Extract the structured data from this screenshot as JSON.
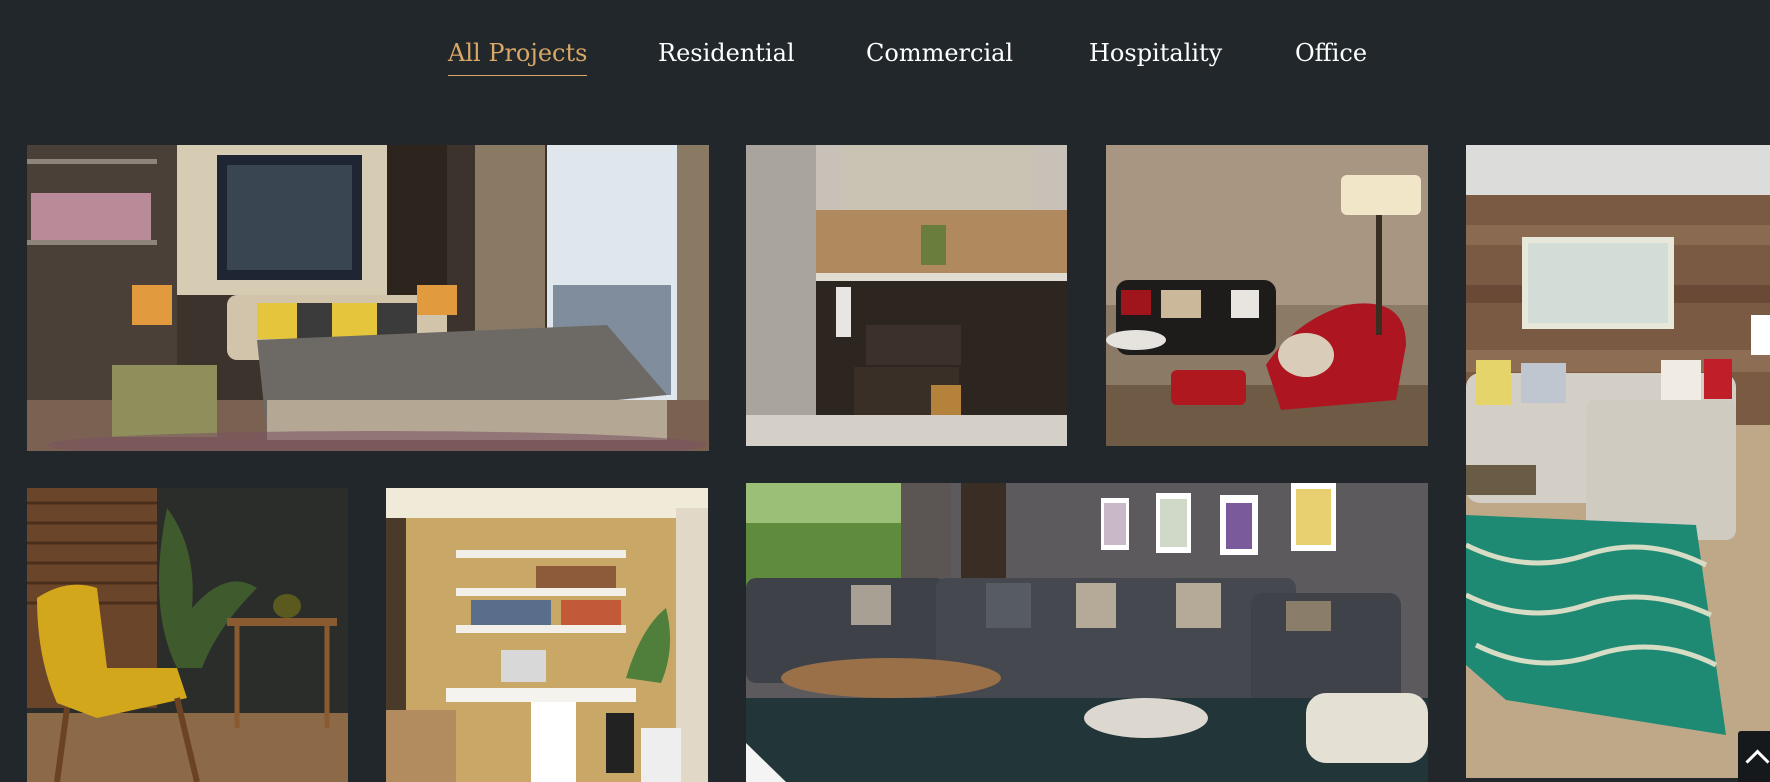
{
  "filters": {
    "items": [
      {
        "label": "All Projects",
        "active": true
      },
      {
        "label": "Residential",
        "active": false
      },
      {
        "label": "Commercial",
        "active": false
      },
      {
        "label": "Hospitality",
        "active": false
      },
      {
        "label": "Office",
        "active": false
      }
    ]
  },
  "colors": {
    "background": "#22272b",
    "accent": "#d9a766",
    "text": "#ffffff"
  },
  "gallery": {
    "tiles": [
      {
        "subject": "bedroom-with-city-window"
      },
      {
        "subject": "dark-wood-kitchen"
      },
      {
        "subject": "lounge-with-red-chairs"
      },
      {
        "subject": "living-room-with-teal-rug"
      },
      {
        "subject": "yellow-armchair-corner"
      },
      {
        "subject": "home-study-desk"
      },
      {
        "subject": "grey-sectional-sofa-living-room"
      }
    ]
  },
  "back_to_top": {
    "icon": "chevron-up-icon"
  }
}
